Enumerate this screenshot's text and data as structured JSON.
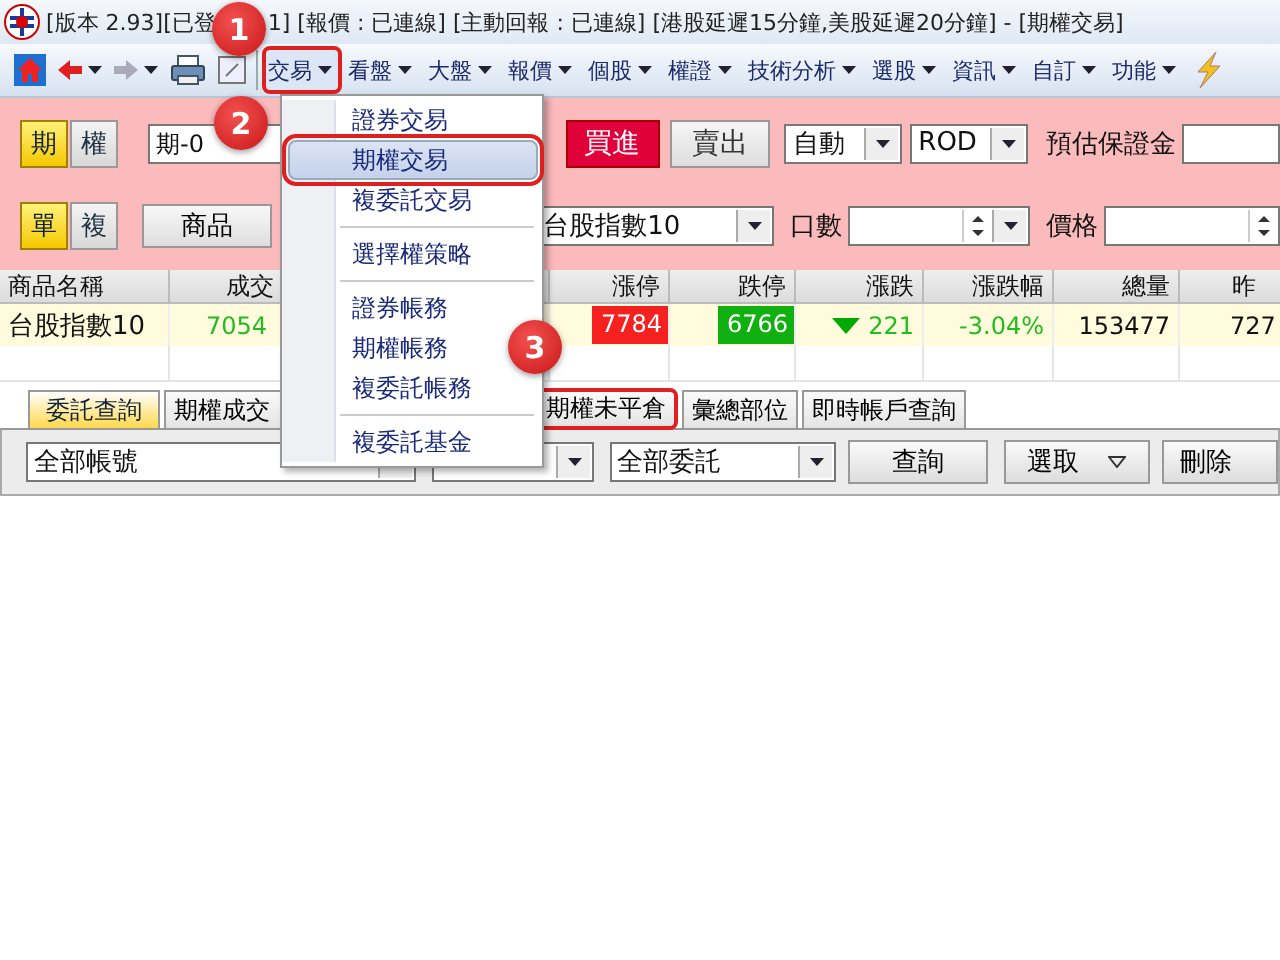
{
  "window": {
    "title_parts": [
      "[版本 2.93][已登",
      "1] [報價 : 已連線] [主動回報 : 已連線] [港股延遲15分鐘,美股延遲20分鐘] - [期權交易]"
    ]
  },
  "toolbar": {
    "menus": [
      {
        "label": "交易",
        "highlighted": true
      },
      {
        "label": "看盤",
        "highlighted": false
      },
      {
        "label": "大盤",
        "highlighted": false
      },
      {
        "label": "報價",
        "highlighted": false
      },
      {
        "label": "個股",
        "highlighted": false
      },
      {
        "label": "權證",
        "highlighted": false
      },
      {
        "label": "技術分析",
        "highlighted": false
      },
      {
        "label": "選股",
        "highlighted": false
      },
      {
        "label": "資訊",
        "highlighted": false
      },
      {
        "label": "自訂",
        "highlighted": false
      },
      {
        "label": "功能",
        "highlighted": false
      }
    ]
  },
  "order_panel": {
    "market_toggle": [
      {
        "label": "期",
        "selected": true
      },
      {
        "label": "權",
        "selected": false
      }
    ],
    "account": "期-0",
    "buy_button": "買進",
    "sell_button": "賣出",
    "condition": "自動",
    "order_type": "ROD",
    "margin_label": "預估保證金",
    "mode_toggle": [
      {
        "label": "單",
        "selected": true
      },
      {
        "label": "複",
        "selected": false
      }
    ],
    "product_button": "商品",
    "product": "台股指數10",
    "quantity_label": "口數",
    "price_label": "價格"
  },
  "quote_table": {
    "columns": [
      {
        "label": "商品名稱",
        "kind": "name"
      },
      {
        "label": "成交",
        "kind": "price"
      },
      {
        "label": "漲停",
        "kind": "limit_up"
      },
      {
        "label": "跌停",
        "kind": "limit_down"
      },
      {
        "label": "漲跌",
        "kind": "change"
      },
      {
        "label": "漲跌幅",
        "kind": "percent"
      },
      {
        "label": "總量",
        "kind": "volume"
      },
      {
        "label": "昨",
        "kind": "previous"
      }
    ],
    "rows": [
      {
        "cells": [
          "台股指數10",
          "7054",
          "7784",
          "6766",
          "221",
          "-3.04%",
          "153477",
          "727"
        ],
        "falling": true
      }
    ]
  },
  "tabs": [
    {
      "label": "委託查詢",
      "selected": true,
      "highlighted": false
    },
    {
      "label": "期權成交",
      "selected": false,
      "highlighted": false
    },
    {
      "label": "期權未平倉",
      "selected": false,
      "highlighted": true
    },
    {
      "label": "彙總部位",
      "selected": false,
      "highlighted": false
    },
    {
      "label": "即時帳戶查詢",
      "selected": false,
      "highlighted": false
    }
  ],
  "filters": {
    "account_select": "全部帳號",
    "order_select": "全部委託",
    "query_button": "查詢",
    "select_button": "選取",
    "delete_button": "刪除"
  },
  "menu": {
    "groups": [
      [
        {
          "label": "證券交易",
          "selected": false,
          "highlighted": false
        },
        {
          "label": "期權交易",
          "selected": true,
          "highlighted": true
        },
        {
          "label": "複委託交易",
          "selected": false,
          "highlighted": false
        }
      ],
      [
        {
          "label": "選擇權策略",
          "selected": false,
          "highlighted": false
        }
      ],
      [
        {
          "label": "證券帳務",
          "selected": false,
          "highlighted": false
        },
        {
          "label": "期權帳務",
          "selected": false,
          "highlighted": false
        },
        {
          "label": "複委託帳務",
          "selected": false,
          "highlighted": false
        }
      ],
      [
        {
          "label": "複委託基金",
          "selected": false,
          "highlighted": false
        }
      ]
    ]
  },
  "steps": [
    "1",
    "2",
    "3"
  ]
}
